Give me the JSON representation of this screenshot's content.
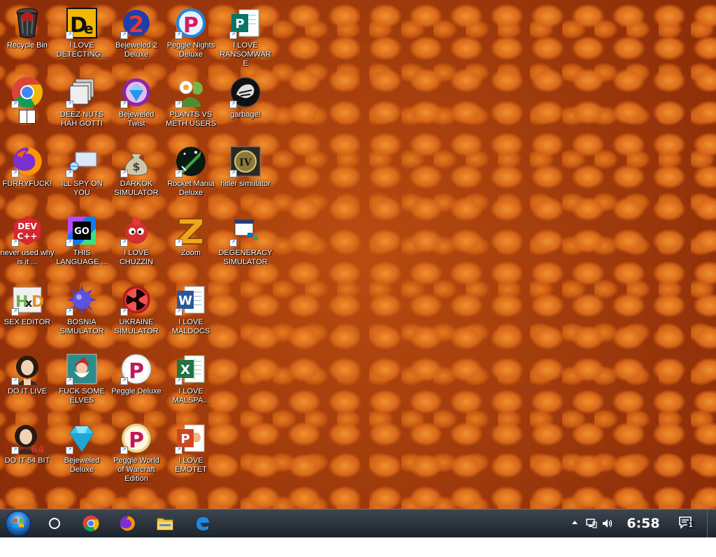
{
  "desktop": {
    "icons": [
      {
        "id": "recycle-bin",
        "label": "Recycle Bin",
        "icon": "recycle-bin-icon",
        "shortcut": false
      },
      {
        "id": "i-love-detecting",
        "label": "I LOVE DETECTING...",
        "icon": "detect-it-easy-icon",
        "shortcut": true
      },
      {
        "id": "bejeweled-2",
        "label": "Bejeweled 2 Deluxe",
        "icon": "bejeweled-2-icon",
        "shortcut": true
      },
      {
        "id": "peggle-nights",
        "label": "Peggle Nights Deluxe",
        "icon": "peggle-nights-icon",
        "shortcut": true
      },
      {
        "id": "i-love-ransomware",
        "label": "I LOVE RANSOMWARE",
        "icon": "publisher-icon",
        "shortcut": true
      },
      {
        "id": "chrome",
        "label": "",
        "icon": "chrome-icon",
        "shortcut": true
      },
      {
        "id": "deez-nuts",
        "label": "DEEZ NUTS HAH GOTTI",
        "icon": "windows-stack-icon",
        "shortcut": true
      },
      {
        "id": "bejeweled-twist",
        "label": "Bejeweled Twist",
        "icon": "bejeweled-twist-icon",
        "shortcut": true
      },
      {
        "id": "plants-vs-meth",
        "label": "PLANTS VS METH USERS",
        "icon": "plants-vs-zombies-icon",
        "shortcut": true
      },
      {
        "id": "garbage",
        "label": "garbage!",
        "icon": "paradox-icon",
        "shortcut": true
      },
      {
        "id": "furryfuck",
        "label": "FURRYFUCK!",
        "icon": "firefox-icon",
        "shortcut": true
      },
      {
        "id": "ill-spy-on-you",
        "label": "ILL SPY ON YOU",
        "icon": "remote-monitor-icon",
        "shortcut": true
      },
      {
        "id": "darkok-simulator",
        "label": "DARKOK SIMULATOR",
        "icon": "money-bag-icon",
        "shortcut": true
      },
      {
        "id": "rocket-mania",
        "label": "Rocket Mania Deluxe",
        "icon": "rocket-mania-icon",
        "shortcut": true
      },
      {
        "id": "hitler-simulator",
        "label": "hitler simulator",
        "icon": "hearts-of-iron-icon",
        "shortcut": true
      },
      {
        "id": "never-used",
        "label": "never used why is it ...",
        "icon": "dev-cpp-icon",
        "shortcut": true
      },
      {
        "id": "this-language",
        "label": "THIS LANGUAGE ...",
        "icon": "goland-icon",
        "shortcut": true
      },
      {
        "id": "i-love-chuzzin",
        "label": "I LOVE CHUZZIN",
        "icon": "chuzzle-icon",
        "shortcut": true
      },
      {
        "id": "zoom",
        "label": "Zoom",
        "icon": "zuma-icon",
        "shortcut": true
      },
      {
        "id": "degeneracy-simulator",
        "label": "DEGENERACY SIMULATOR",
        "icon": "windows-app-icon",
        "shortcut": true
      },
      {
        "id": "sex-editor",
        "label": "SEX EDITOR",
        "icon": "hxd-icon",
        "shortcut": true
      },
      {
        "id": "bosnia-simulator",
        "label": "BOSNIA SIMULATOR",
        "icon": "spiked-ball-icon",
        "shortcut": true
      },
      {
        "id": "ukraine-simulator",
        "label": "UKRAINE SIMULATOR",
        "icon": "radiation-icon",
        "shortcut": true
      },
      {
        "id": "i-love-maldocs",
        "label": "I LOVE MALDOCS",
        "icon": "word-icon",
        "shortcut": true
      },
      {
        "id": "do-it-live",
        "label": "DO IT LIVE",
        "icon": "portrait-icon",
        "shortcut": true
      },
      {
        "id": "fuck-some-elves",
        "label": "FUCK SOME ELVES",
        "icon": "santa-icon",
        "shortcut": true
      },
      {
        "id": "peggle-deluxe",
        "label": "Peggle Deluxe",
        "icon": "peggle-icon",
        "shortcut": true
      },
      {
        "id": "i-love-malspa",
        "label": "I LOVE MALSPA...",
        "icon": "excel-icon",
        "shortcut": true
      },
      {
        "id": "do-it-64-bit",
        "label": "DO IT 64 BIT",
        "icon": "portrait-64-icon",
        "shortcut": true
      },
      {
        "id": "bejeweled-deluxe",
        "label": "Bejeweled Deluxe",
        "icon": "diamond-icon",
        "shortcut": true
      },
      {
        "id": "peggle-warcraft",
        "label": "Peggle World of Warcraft Edition",
        "icon": "peggle-warcraft-icon",
        "shortcut": true
      },
      {
        "id": "i-love-emotet",
        "label": "I LOVE EMOTET",
        "icon": "powerpoint-icon",
        "shortcut": true
      }
    ]
  },
  "taskbar": {
    "pinned": [
      {
        "id": "start",
        "icon": "windows-start-icon"
      },
      {
        "id": "cortana",
        "icon": "cortana-circle-icon"
      },
      {
        "id": "chrome",
        "icon": "chrome-icon"
      },
      {
        "id": "firefox",
        "icon": "firefox-icon"
      },
      {
        "id": "file-explorer",
        "icon": "folder-icon"
      },
      {
        "id": "edge",
        "icon": "edge-icon"
      }
    ],
    "clock": "6:58 AM",
    "notification_count": "1"
  }
}
